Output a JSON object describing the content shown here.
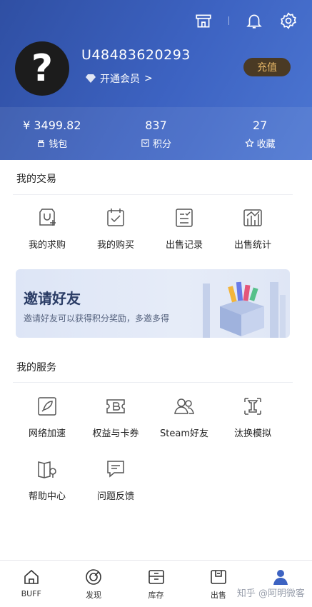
{
  "header": {
    "icons": [
      "store-icon",
      "bell-icon",
      "gear-icon"
    ],
    "avatar_glyph": "?",
    "user_id": "U48483620293",
    "vip_label": "开通会员",
    "vip_arrow": ">",
    "recharge_label": "充值"
  },
  "stats": [
    {
      "value": "¥ 3499.82",
      "label": "钱包",
      "icon": "wallet-icon"
    },
    {
      "value": "837",
      "label": "积分",
      "icon": "points-icon"
    },
    {
      "value": "27",
      "label": "收藏",
      "icon": "star-icon"
    }
  ],
  "trade": {
    "title": "我的交易",
    "items": [
      {
        "label": "我的求购",
        "icon": "bag-plus-icon"
      },
      {
        "label": "我的购买",
        "icon": "calendar-check-icon"
      },
      {
        "label": "出售记录",
        "icon": "record-list-icon"
      },
      {
        "label": "出售统计",
        "icon": "stats-chart-icon"
      }
    ]
  },
  "banner": {
    "title": "邀请好友",
    "subtitle": "邀请好友可以获得积分奖励，多邀多得"
  },
  "services": {
    "title": "我的服务",
    "items": [
      {
        "label": "网络加速",
        "icon": "rocket-icon"
      },
      {
        "label": "权益与卡券",
        "icon": "ticket-icon"
      },
      {
        "label": "Steam好友",
        "icon": "friends-icon"
      },
      {
        "label": "汰换模拟",
        "icon": "trade-up-icon"
      },
      {
        "label": "帮助中心",
        "icon": "help-book-icon"
      },
      {
        "label": "问题反馈",
        "icon": "feedback-icon"
      }
    ]
  },
  "tabbar": {
    "items": [
      {
        "label": "BUFF",
        "icon": "home-icon"
      },
      {
        "label": "发现",
        "icon": "discover-icon"
      },
      {
        "label": "库存",
        "icon": "inventory-icon"
      },
      {
        "label": "出售",
        "icon": "sell-icon"
      },
      {
        "label": "我的",
        "icon": "profile-icon"
      }
    ],
    "active_color": "#3d63c2"
  },
  "watermark": "知乎 @阿明微客",
  "colors": {
    "header": "#3d63c2",
    "recharge_bg": "#4a3a24",
    "recharge_text": "#e8b969"
  }
}
